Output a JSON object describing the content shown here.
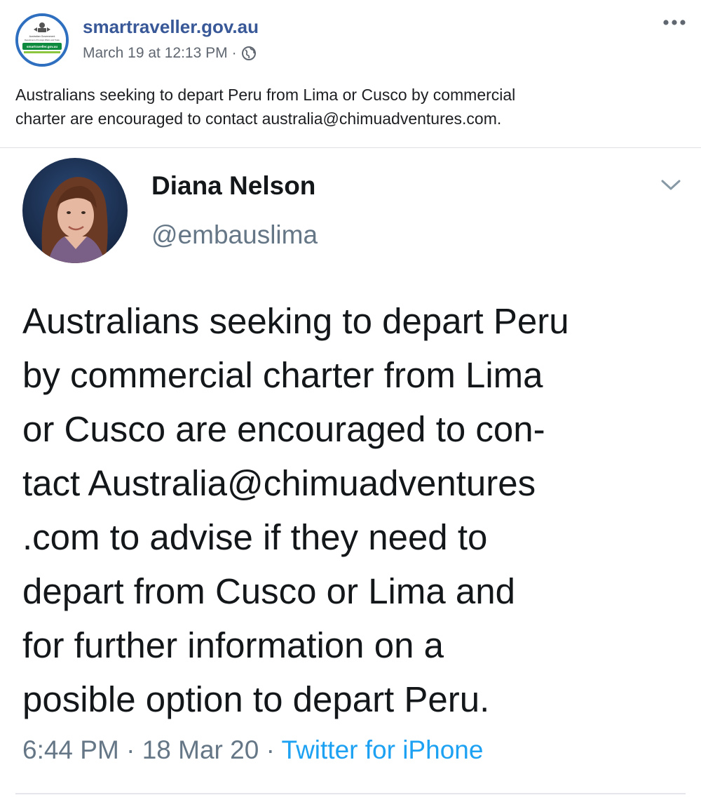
{
  "post": {
    "page_name": "smartraveller.gov.au",
    "timestamp": "March 19 at 12:13 PM",
    "separator": "·",
    "privacy_icon": "globe-icon",
    "more_icon": "more-options-icon",
    "caption_lines": [
      "Australians seeking to depart Peru from Lima or Cusco by commercial",
      "charter are encouraged to contact australia@chimuadventures.com."
    ],
    "logo": {
      "line1": "Australian Government",
      "line2": "Department of Foreign Affairs and Trade",
      "badge": "smartraveller.gov.au",
      "brand_color": "#2f6fc0",
      "badge_color": "#0e8a3e"
    }
  },
  "tweet": {
    "display_name": "Diana Nelson",
    "handle": "@embauslima",
    "chevron_icon": "chevron-down-icon",
    "text_lines": [
      "Australians seeking to depart Peru",
      "by commercial charter from Lima",
      "or Cusco are encouraged to con-",
      "tact Australia@chimuadventures",
      ".com to advise if they need to",
      "depart from Cusco or Lima and",
      "for further information on a",
      "posible option to depart Peru."
    ],
    "time": "6:44 PM",
    "date": "18 Mar 20",
    "separator": "·",
    "source": "Twitter for iPhone"
  },
  "colors": {
    "link_blue": "#385898",
    "twitter_blue": "#1da1f2",
    "meta_gray": "#606770",
    "tweet_gray": "#657786"
  }
}
